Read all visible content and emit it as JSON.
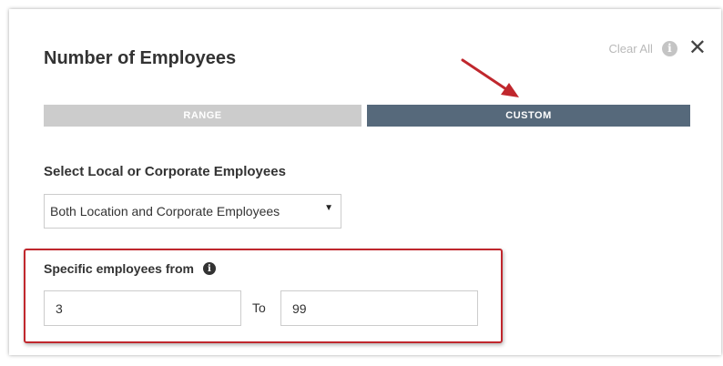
{
  "header": {
    "title": "Number of Employees",
    "clear_all": "Clear All",
    "info_icon": "i",
    "close_icon": "✕"
  },
  "tabs": [
    {
      "label": "RANGE",
      "active": false
    },
    {
      "label": "CUSTOM",
      "active": true
    }
  ],
  "employee_type": {
    "label": "Select Local or Corporate Employees",
    "selected": "Both Location and Corporate Employees",
    "arrow_icon": "▼"
  },
  "specific": {
    "label": "Specific employees from",
    "info_icon": "i",
    "from_value": "3",
    "to_label": "To",
    "to_value": "99"
  },
  "colors": {
    "active_tab": "#56697b",
    "inactive_tab": "#cccccc",
    "annotation_red": "#c0272d"
  }
}
